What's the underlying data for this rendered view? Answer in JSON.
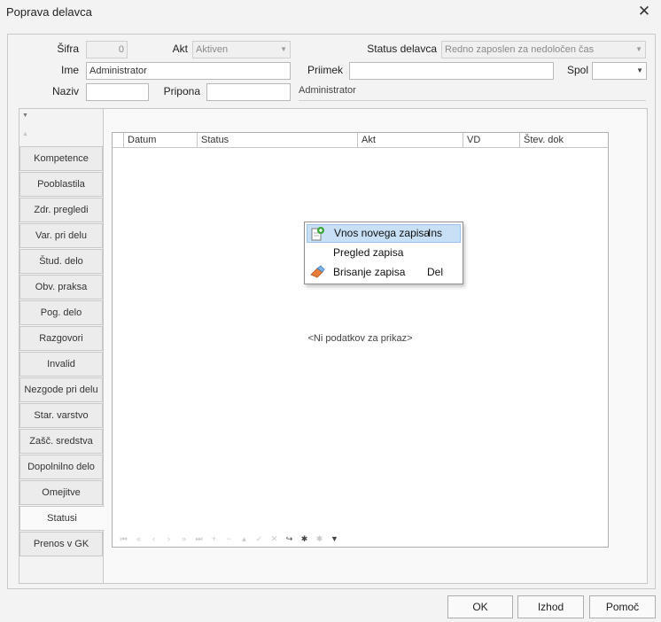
{
  "window": {
    "title": "Poprava delavca"
  },
  "form": {
    "sifra_label": "Šifra",
    "sifra_value": "0",
    "akt_label": "Akt",
    "akt_value": "Aktiven",
    "status_label": "Status delavca",
    "status_value": "Redno zaposlen za nedoločen čas",
    "ime_label": "Ime",
    "ime_value": "Administrator",
    "priimek_label": "Priimek",
    "priimek_value": "",
    "spol_label": "Spol",
    "spol_value": "",
    "naziv_label": "Naziv",
    "naziv_value": "",
    "pripona_label": "Pripona",
    "pripona_value": "",
    "display_name": "Administrator"
  },
  "tabs": [
    {
      "label": "Kompetence"
    },
    {
      "label": "Pooblastila"
    },
    {
      "label": "Zdr. pregledi"
    },
    {
      "label": "Var. pri delu"
    },
    {
      "label": "Štud. delo"
    },
    {
      "label": "Obv. praksa"
    },
    {
      "label": "Pog. delo"
    },
    {
      "label": "Razgovori"
    },
    {
      "label": "Invalid"
    },
    {
      "label": "Nezgode pri delu"
    },
    {
      "label": "Star. varstvo"
    },
    {
      "label": "Zašč. sredstva"
    },
    {
      "label": "Dopolnilno delo"
    },
    {
      "label": "Omejitve"
    },
    {
      "label": "Statusi",
      "active": true
    },
    {
      "label": "Prenos v GK"
    }
  ],
  "grid": {
    "columns": [
      "Datum",
      "Status",
      "Akt",
      "VD",
      "Štev. dok"
    ],
    "empty_text": "<Ni podatkov za prikaz>"
  },
  "context_menu": {
    "items": [
      {
        "label": "Vnos novega zapisa",
        "shortcut": "Ins",
        "icon": "new-record-icon"
      },
      {
        "label": "Pregled zapisa",
        "shortcut": "",
        "icon": ""
      },
      {
        "label": "Brisanje zapisa",
        "shortcut": "Del",
        "icon": "eraser-icon"
      }
    ]
  },
  "buttons": {
    "ok": "OK",
    "izhod": "Izhod",
    "pomoc": "Pomoč"
  },
  "colors": {
    "menu_highlight": "#c7e0f5",
    "field_border": "#b9b9b9",
    "background": "#f3f3f3"
  }
}
